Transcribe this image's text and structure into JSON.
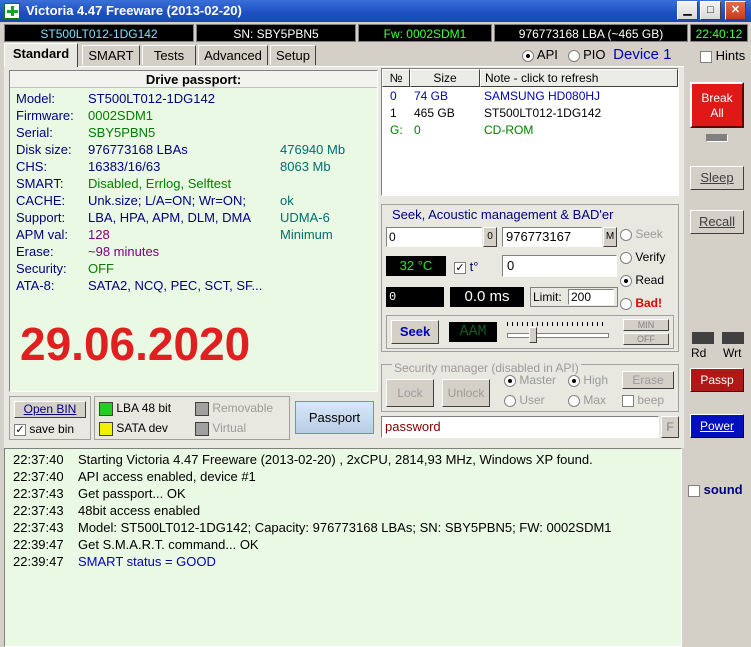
{
  "window": {
    "title": "Victoria 4.47   Freeware (2013-02-20)"
  },
  "status": {
    "model": "ST500LT012-1DG142",
    "serial": "SN: SBY5PBN5",
    "firmware": "Fw: 0002SDM1",
    "lba": "976773168 LBA (~465 GB)",
    "clock": "22:40:12"
  },
  "tabs": [
    "Standard",
    "SMART",
    "Tests",
    "Advanced",
    "Setup"
  ],
  "api": {
    "api_label": "API",
    "pio_label": "PIO",
    "device": "Device 1",
    "hints": "Hints"
  },
  "passport": {
    "heading": "Drive passport:",
    "rows": [
      {
        "label": "Model:",
        "value": "ST500LT012-1DG142",
        "extra": ""
      },
      {
        "label": "Firmware:",
        "value": "0002SDM1",
        "extra": ""
      },
      {
        "label": "Serial:",
        "value": "SBY5PBN5",
        "extra": ""
      },
      {
        "label": "Disk size:",
        "value": "976773168 LBAs",
        "extra": "476940 Mb"
      },
      {
        "label": "CHS:",
        "value": "16383/16/63",
        "extra": "8063 Mb"
      },
      {
        "label": "SMART:",
        "value": "Disabled, Errlog, Selftest",
        "extra": ""
      },
      {
        "label": "CACHE:",
        "value": "Unk.size; L/A=ON; Wr=ON;",
        "extra": "ok"
      },
      {
        "label": "Support:",
        "value": "LBA, HPA, APM, DLM, DMA",
        "extra": "UDMA-6"
      },
      {
        "label": "APM val:",
        "value": "128",
        "extra": "Minimum"
      },
      {
        "label": "Erase:",
        "value": "~98 minutes",
        "extra": ""
      },
      {
        "label": "Security:",
        "value": "OFF",
        "extra": ""
      },
      {
        "label": "ATA-8:",
        "value": "SATA2, NCQ, PEC, SCT, SF...",
        "extra": ""
      }
    ],
    "date_overlay": "29.06.2020"
  },
  "drive_table": {
    "headers": [
      "№",
      "Size",
      "Note - click to refresh"
    ],
    "rows": [
      {
        "n": "0",
        "size": "74 GB",
        "note": "SAMSUNG HD080HJ"
      },
      {
        "n": "1",
        "size": "465 GB",
        "note": "ST500LT012-1DG142"
      },
      {
        "n": "G:",
        "size": "0",
        "note": "CD-ROM"
      }
    ]
  },
  "seek": {
    "title": "Seek, Acoustic management & BAD'er",
    "start": "0",
    "start_btn": "0",
    "end": "976773167",
    "end_btn": "M",
    "temp": "32 °C",
    "t_label": "t°",
    "field": "0",
    "lcd1": "0",
    "time": "0.0 ms",
    "limit_label": "Limit:",
    "limit": "200",
    "seek_btn": "Seek",
    "aam": "AAM",
    "min": "MIN",
    "off": "OFF",
    "modes": [
      "Seek",
      "Verify",
      "Read",
      "Bad!"
    ]
  },
  "security": {
    "title": "Security manager (disabled in API)",
    "lock": "Lock",
    "unlock": "Unlock",
    "master": "Master",
    "high": "High",
    "erase": "Erase",
    "user": "User",
    "max": "Max",
    "beep": "beep",
    "password": "password",
    "f_btn": "F"
  },
  "bottom": {
    "open_bin": "Open BIN",
    "save_bin": "save bin",
    "lba48": "LBA 48 bit",
    "removable": "Removable",
    "sata": "SATA dev",
    "virtual": "Virtual",
    "passport_btn": "Passport"
  },
  "right": {
    "break_all": "Break\nAll",
    "sleep": "Sleep",
    "recall": "Recall",
    "rd": "Rd",
    "wrt": "Wrt",
    "passp": "Passp",
    "power": "Power",
    "sound": "sound"
  },
  "log": [
    {
      "time": "22:37:40",
      "msg": "Starting Victoria 4.47  Freeware (2013-02-20) , 2xCPU, 2814,93 MHz, Windows XP found.",
      "blue": false
    },
    {
      "time": "22:37:40",
      "msg": "API access enabled, device #1",
      "blue": false
    },
    {
      "time": "22:37:43",
      "msg": "Get passport... OK",
      "blue": false
    },
    {
      "time": "22:37:43",
      "msg": "48bit access enabled",
      "blue": false
    },
    {
      "time": "22:37:43",
      "msg": "Model: ST500LT012-1DG142; Capacity: 976773168 LBAs; SN: SBY5PBN5; FW: 0002SDM1",
      "blue": false
    },
    {
      "time": "22:39:47",
      "msg": "Get S.M.A.R.T. command... OK",
      "blue": false
    },
    {
      "time": "22:39:47",
      "msg": "SMART status = GOOD",
      "blue": true
    }
  ],
  "colors": {
    "title_blue": "#1e4fc2",
    "status_bg": "#000000",
    "passport_bg": "#e9f9e3",
    "break_red": "#e01818",
    "power_blue": "#0010c0",
    "date_red": "#e02020"
  }
}
